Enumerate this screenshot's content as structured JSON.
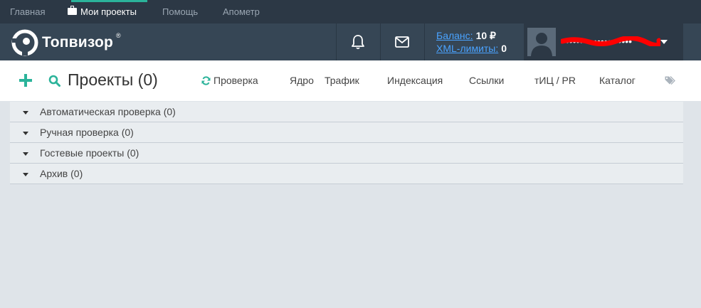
{
  "topnav": {
    "items": [
      {
        "label": "Главная",
        "active": false
      },
      {
        "label": "Мои проекты",
        "active": true
      },
      {
        "label": "Помощь",
        "active": false
      },
      {
        "label": "Апометр",
        "active": false
      }
    ]
  },
  "header": {
    "logo_text": "Топвизор",
    "logo_reg": "®",
    "icons": [
      "bell-icon",
      "mail-icon"
    ],
    "balance_label": "Баланс:",
    "balance_value": "10 ₽",
    "xml_label": "XML-лимиты:",
    "xml_value": "0",
    "username": "••••••••••••••••••••"
  },
  "toolbar": {
    "title": "Проекты (0)",
    "links": [
      "Проверка",
      "Ядро",
      "Трафик",
      "Индексация",
      "Ссылки",
      "тИЦ / PR",
      "Каталог"
    ],
    "icons": [
      "plus-icon",
      "search-icon",
      "refresh-icon",
      "tags-icon"
    ]
  },
  "groups": [
    {
      "label": "Автоматическая проверка (0)"
    },
    {
      "label": "Ручная проверка (0)"
    },
    {
      "label": "Гостевые проекты (0)"
    },
    {
      "label": "Архив (0)"
    }
  ],
  "colors": {
    "topnav_bg": "#2c3845",
    "header_bg": "#364655",
    "accent": "#2bb39a",
    "link_blue": "#4aa3ff",
    "page_bg": "#dfe4e9"
  }
}
